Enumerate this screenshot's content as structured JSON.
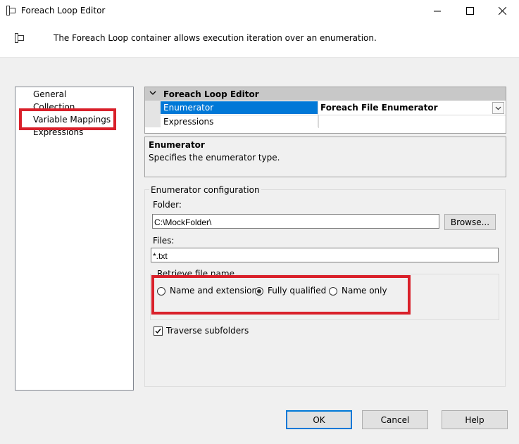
{
  "window": {
    "title": "Foreach Loop Editor",
    "header_text": "The Foreach Loop container allows execution iteration over an enumeration."
  },
  "nav": {
    "items": [
      {
        "label": "General"
      },
      {
        "label": "Collection"
      },
      {
        "label": "Variable Mappings"
      },
      {
        "label": "Expressions"
      }
    ]
  },
  "grid": {
    "section_title": "Foreach Loop Editor",
    "rows": [
      {
        "name": "Enumerator",
        "value": "Foreach File Enumerator"
      },
      {
        "name": "Expressions",
        "value": ""
      }
    ]
  },
  "description": {
    "title": "Enumerator",
    "text": "Specifies the enumerator type."
  },
  "config": {
    "group_label": "Enumerator configuration",
    "folder_label": "Folder:",
    "folder_value": "C:\\MockFolder\\",
    "browse_label": "Browse...",
    "files_label": "Files:",
    "files_value": "*.txt",
    "retrieve_label": "Retrieve file name",
    "radio_options": [
      {
        "label": "Name and extension",
        "selected": false
      },
      {
        "label": "Fully qualified",
        "selected": true
      },
      {
        "label": "Name only",
        "selected": false
      }
    ],
    "traverse_label": "Traverse subfolders",
    "traverse_checked": true
  },
  "buttons": {
    "ok": "OK",
    "cancel": "Cancel",
    "help": "Help"
  },
  "colors": {
    "accent": "#0078d7",
    "highlight_annotation": "#d9202a"
  }
}
